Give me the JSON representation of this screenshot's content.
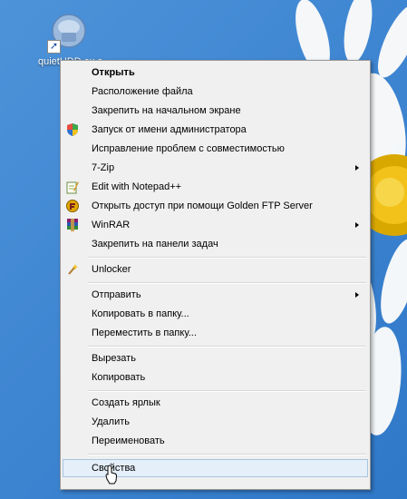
{
  "desktop": {
    "icon_label": "quietHDD.ex e -"
  },
  "menu": {
    "items": [
      {
        "label": "Открыть",
        "bold": true
      },
      {
        "label": "Расположение файла"
      },
      {
        "label": "Закрепить на начальном экране"
      },
      {
        "label": "Запуск от имени администратора",
        "icon": "uac-shield-icon"
      },
      {
        "label": "Исправление проблем с совместимостью"
      },
      {
        "label": "7-Zip",
        "submenu": true
      },
      {
        "label": "Edit with Notepad++",
        "icon": "notepad-plus-plus-icon"
      },
      {
        "label": "Открыть доступ при помощи Golden FTP Server",
        "icon": "golden-ftp-icon"
      },
      {
        "label": "WinRAR",
        "submenu": true,
        "icon": "winrar-icon"
      },
      {
        "label": "Закрепить на панели задач"
      },
      {
        "label": "Unlocker",
        "icon": "unlocker-wand-icon"
      },
      {
        "label": "Отправить",
        "submenu": true
      },
      {
        "label": "Копировать в папку..."
      },
      {
        "label": "Переместить в папку..."
      },
      {
        "label": "Вырезать"
      },
      {
        "label": "Копировать"
      },
      {
        "label": "Создать ярлык"
      },
      {
        "label": "Удалить"
      },
      {
        "label": "Переименовать"
      },
      {
        "label": "Свойства",
        "highlighted": true
      }
    ]
  },
  "colors": {
    "desktop_blue": "#3f86d2",
    "menu_bg": "#f0f0f0",
    "hover_bg": "#e5eff9",
    "hover_border": "#a8c4e0"
  }
}
